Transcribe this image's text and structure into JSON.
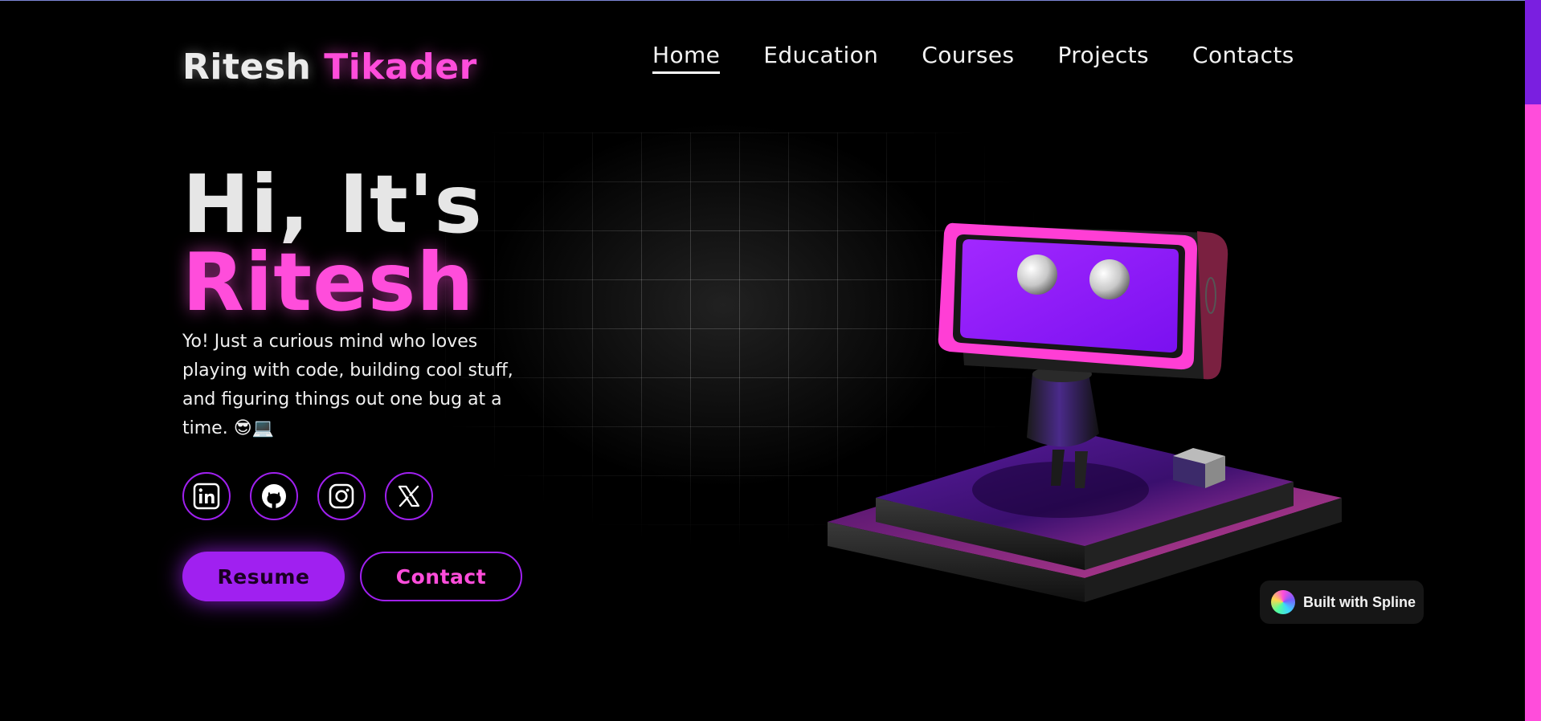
{
  "header": {
    "logo_first": "Ritesh",
    "logo_last": "Tikader",
    "nav": [
      {
        "label": "Home",
        "active": true
      },
      {
        "label": "Education",
        "active": false
      },
      {
        "label": "Courses",
        "active": false
      },
      {
        "label": "Projects",
        "active": false
      },
      {
        "label": "Contacts",
        "active": false
      }
    ]
  },
  "hero": {
    "greeting": "Hi, It's",
    "name": "Ritesh",
    "description": "Yo! Just a curious mind who loves playing with code, building cool stuff, and figuring things out one bug at a time. 😎💻"
  },
  "socials": [
    {
      "icon": "linkedin-icon"
    },
    {
      "icon": "github-icon"
    },
    {
      "icon": "instagram-icon"
    },
    {
      "icon": "x-icon"
    }
  ],
  "buttons": {
    "resume": "Resume",
    "contact": "Contact"
  },
  "badge": {
    "label": "Built with Spline"
  },
  "colors": {
    "accent_pink": "#ff4ddb",
    "accent_purple": "#a020f0",
    "background": "#000000"
  }
}
